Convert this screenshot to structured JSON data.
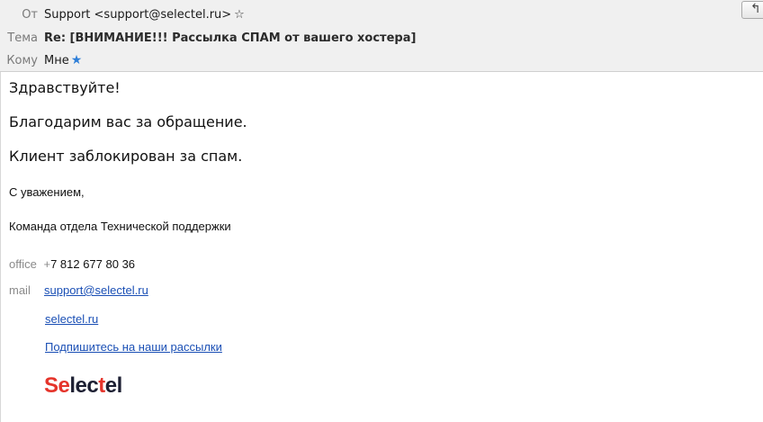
{
  "header": {
    "from_label": "От",
    "from_value": "Support <support@selectel.ru>",
    "subject_label": "Тема",
    "subject_value": "Re: [ВНИМАНИЕ!!! Рассылка СПАМ от вашего хостера]",
    "to_label": "Кому",
    "to_value": "Мне",
    "from_star_icon": "star-outline-icon",
    "to_star_icon": "star-filled-icon",
    "reply_icon": "reply-icon",
    "accent_color": "#2f7fd8"
  },
  "message": {
    "greeting": "Здравствуйте!",
    "thanks": "Благодарим вас за обращение.",
    "status": "Клиент заблокирован за спам.",
    "regards": "С уважением,",
    "team": "Команда отдела Технической поддержки"
  },
  "signature": {
    "office_label": "office",
    "office_prefix": "+",
    "office_phone": "7 812 677 80 36",
    "mail_label": "mail",
    "mail_value": "support@selectel.ru",
    "site_link": "selectel.ru",
    "subscribe_link": "Подпишитесь на наши рассылки",
    "logo_part1": "Se",
    "logo_part2": "lec",
    "logo_part3": "t",
    "logo_part4": "el",
    "logo_text": "Selectel",
    "logo_red_color": "#e5342b",
    "logo_dark_color": "#1d2033"
  }
}
